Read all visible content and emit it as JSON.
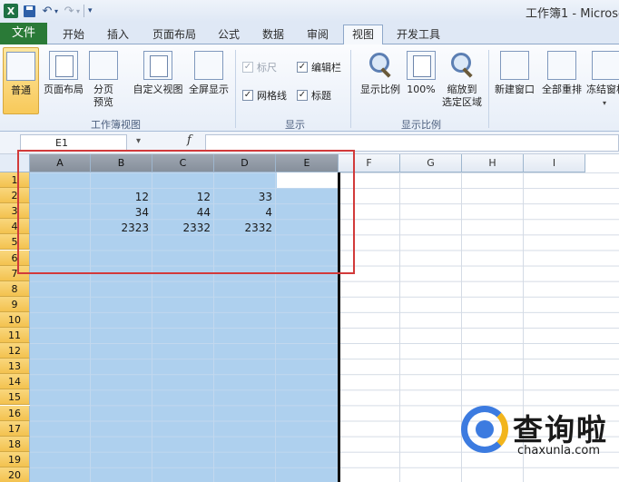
{
  "title_bar": {
    "title": "工作簿1 - Microso",
    "app_logo": "X"
  },
  "tabs": {
    "file": "文件",
    "items": [
      "开始",
      "插入",
      "页面布局",
      "公式",
      "数据",
      "审阅",
      "视图",
      "开发工具"
    ],
    "active": "视图"
  },
  "ribbon": {
    "workbook_views": {
      "label": "工作簿视图",
      "normal": "普通",
      "page_layout": "页面布局",
      "page_break_1": "分页",
      "page_break_2": "预览",
      "custom_views": "自定义视图",
      "full_screen": "全屏显示"
    },
    "show": {
      "label": "显示",
      "ruler": "标尺",
      "formula_bar": "编辑栏",
      "gridlines": "网格线",
      "headings": "标题"
    },
    "zoom": {
      "label": "显示比例",
      "zoom": "显示比例",
      "hundred": "100%",
      "zoom_sel_1": "缩放到",
      "zoom_sel_2": "选定区域"
    },
    "window": {
      "new_window": "新建窗口",
      "arrange_all": "全部重排",
      "freeze_panes": "冻结窗格"
    }
  },
  "formula_bar": {
    "name_box": "E1",
    "fx": "f",
    "sep": "▾"
  },
  "sheet": {
    "columns": [
      "A",
      "B",
      "C",
      "D",
      "E",
      "F",
      "G",
      "H",
      "I"
    ],
    "rows": [
      "1",
      "2",
      "3",
      "4",
      "5",
      "6",
      "7",
      "8",
      "9",
      "10",
      "11",
      "12",
      "13",
      "14",
      "15",
      "16",
      "17",
      "18",
      "19",
      "20"
    ],
    "cells": {
      "B2": "12",
      "C2": "12",
      "D2": "33",
      "B3": "34",
      "C3": "44",
      "D3": "4",
      "B4": "2323",
      "C4": "2332",
      "D4": "2332"
    }
  },
  "watermark": {
    "cn": "查询啦",
    "en": "chaxunla.com"
  }
}
